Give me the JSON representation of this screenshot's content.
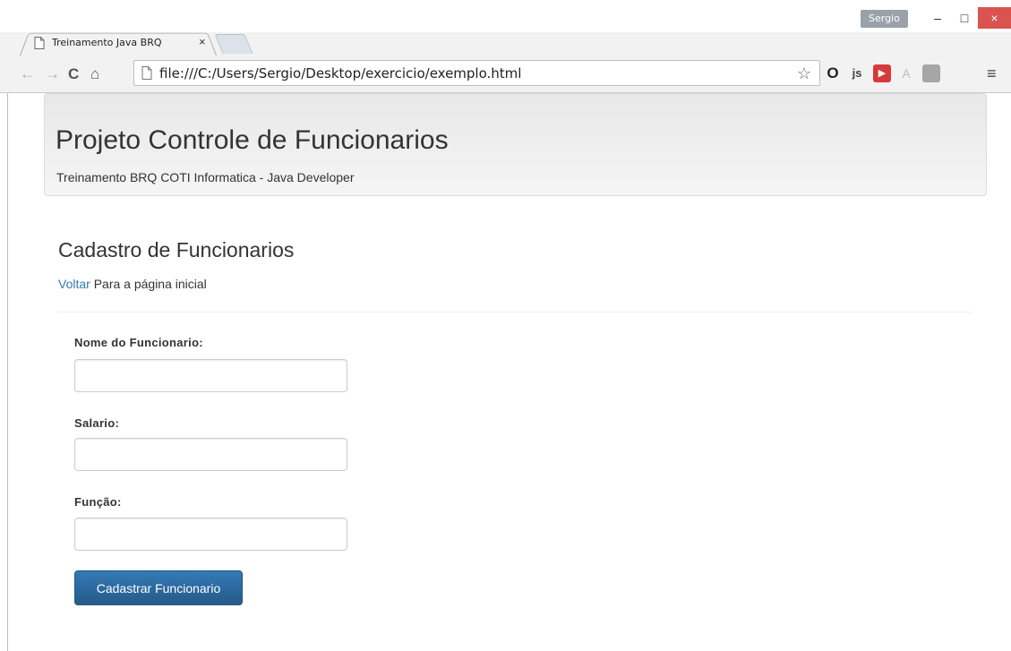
{
  "browser": {
    "tab_title": "Treinamento Java BRQ",
    "tab_close": "×",
    "user": "Sergio",
    "url": "file:///C:/Users/Sergio/Desktop/exercicio/exemplo.html",
    "window_controls": {
      "minimize": "–",
      "maximize": "□",
      "close": "×"
    },
    "nav": {
      "back": "←",
      "forward": "→",
      "reload": "C",
      "home": "⌂"
    },
    "extensions": [
      "opera-icon",
      "js-icon",
      "red-forward-icon",
      "angular-icon",
      "gray-square-icon"
    ],
    "menu": "≡",
    "colors": {
      "close_button": "#d9534f",
      "user_badge": "#9aa1a8"
    }
  },
  "page": {
    "jumbotron": {
      "title": "Projeto Controle de Funcionarios",
      "subtitle": "Treinamento BRQ COTI Informatica - Java Developer"
    },
    "section_title": "Cadastro de Funcionarios",
    "back": {
      "link_text": "Voltar",
      "rest_text": " Para a página inicial"
    },
    "form": {
      "nome_label": "Nome do Funcionario:",
      "nome_value": "",
      "salario_label": "Salario:",
      "salario_value": "",
      "funcao_label": "Função:",
      "funcao_value": "",
      "submit_label": "Cadastrar Funcionario"
    },
    "colors": {
      "link": "#337ab7",
      "primary_button": "#337ab7"
    }
  }
}
